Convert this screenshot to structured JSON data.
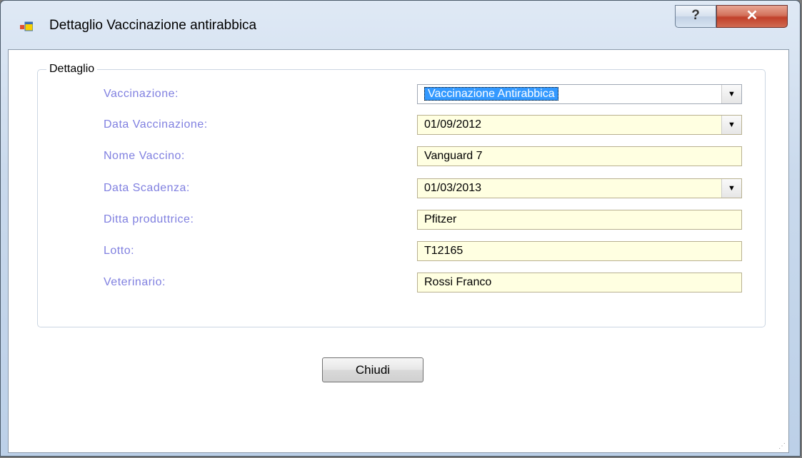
{
  "window": {
    "title": "Dettaglio Vaccinazione antirabbica",
    "help_glyph": "?",
    "close_glyph": "✕"
  },
  "group": {
    "title": "Dettaglio"
  },
  "fields": [
    {
      "label": "Vaccinazione:",
      "value": "Vaccinazione Antirabbica"
    },
    {
      "label": "Data Vaccinazione:",
      "value": "01/09/2012"
    },
    {
      "label": "Nome Vaccino:",
      "value": "Vanguard 7"
    },
    {
      "label": "Data Scadenza:",
      "value": "01/03/2013"
    },
    {
      "label": "Ditta produttrice:",
      "value": "Pfitzer"
    },
    {
      "label": "Lotto:",
      "value": "T12165"
    },
    {
      "label": "Veterinario:",
      "value": "Rossi Franco"
    }
  ],
  "buttons": {
    "close_label": "Chiudi"
  },
  "colors": {
    "label": "#8080e0",
    "field_bg": "#ffffe1",
    "selection": "#3399ff",
    "close_red": "#c1402a"
  }
}
